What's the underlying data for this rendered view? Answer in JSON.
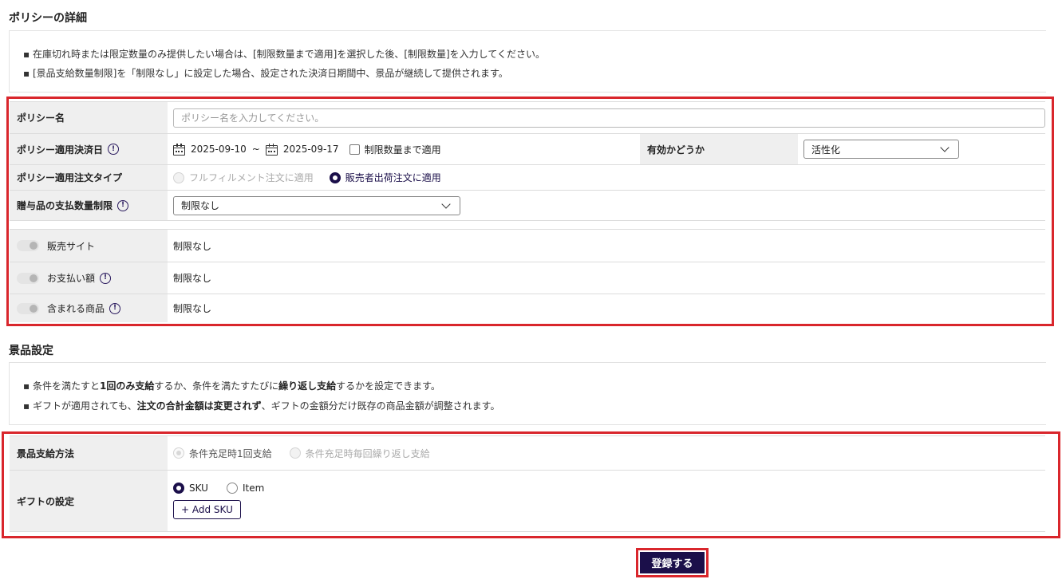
{
  "policy": {
    "title": "ポリシーの詳細",
    "notices": [
      "在庫切れ時または限定数量のみ提供したい場合は、[制限数量まで適用]を選択した後、[制限数量]を入力してください。",
      "[景品支給数量制限]を「制限なし」に設定した場合、設定された決済日期間中、景品が継続して提供されます。"
    ],
    "name_label": "ポリシー名",
    "name_placeholder": "ポリシー名を入力してください。",
    "date_label": "ポリシー適用決済日",
    "date_start": "2025-09-10",
    "date_sep": "~",
    "date_end": "2025-09-17",
    "limit_checkbox_label": "制限数量まで適用",
    "valid_label": "有効かどうか",
    "valid_value": "活性化",
    "order_type_label": "ポリシー適用注文タイプ",
    "order_type_options": [
      "フルフィルメント注文に適用",
      "販売者出荷注文に適用"
    ],
    "gift_limit_label": "贈与品の支払数量制限",
    "gift_limit_value": "制限なし",
    "conditions": [
      {
        "label": "販売サイト",
        "value": "制限なし"
      },
      {
        "label": "お支払い額",
        "value": "制限なし"
      },
      {
        "label": "含まれる商品",
        "value": "制限なし"
      }
    ]
  },
  "prize": {
    "title": "景品設定",
    "notice1": {
      "a": "条件を満たすと",
      "b": "1回のみ支給",
      "c": "するか、条件を満たすたびに",
      "d": "繰り返し支給",
      "e": "するかを設定できます。"
    },
    "notice2": {
      "a": "ギフトが適用されても、",
      "b": "注文の合計金額は変更されず",
      "c": "、ギフトの金額分だけ既存の商品金額が調整されます。"
    },
    "method_label": "景品支給方法",
    "method_options": [
      "条件充足時1回支給",
      "条件充足時毎回繰り返し支給"
    ],
    "gift_setting_label": "ギフトの設定",
    "gift_options": [
      "SKU",
      "Item"
    ],
    "add_sku_label": "+ Add SKU"
  },
  "info_mark": "!",
  "submit_label": "登録する",
  "colors": {
    "accent": "#1b0f4a",
    "highlight": "#d9262c"
  }
}
